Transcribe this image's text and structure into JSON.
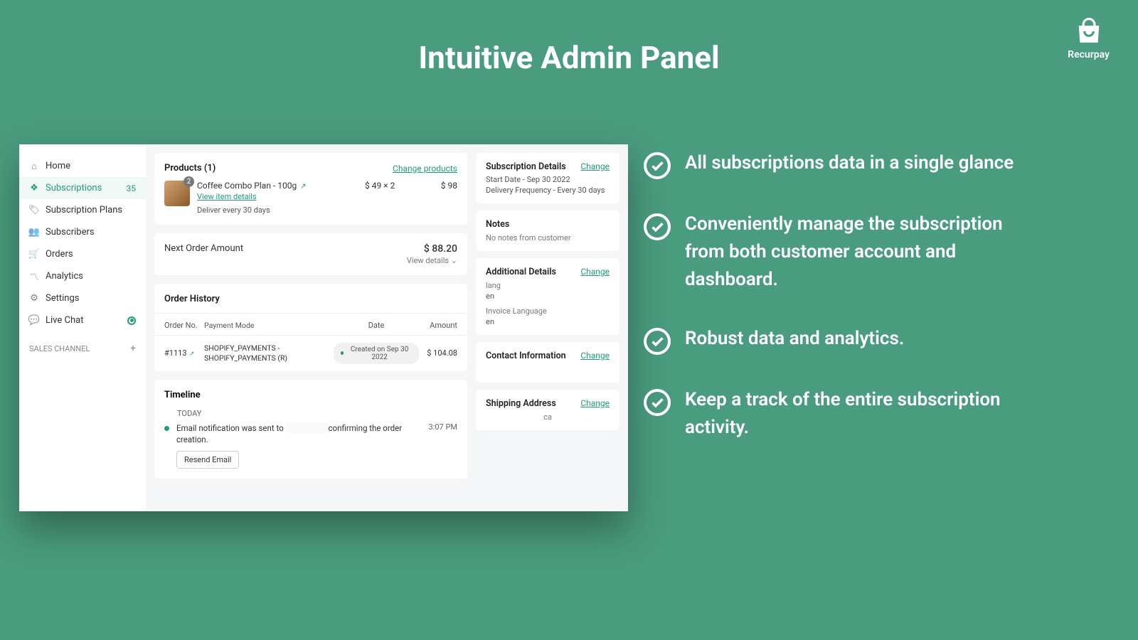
{
  "hero": {
    "title": "Intuitive Admin Panel",
    "brand": "Recurpay"
  },
  "sidebar": {
    "items": [
      {
        "label": "Home"
      },
      {
        "label": "Subscriptions",
        "badge": "35"
      },
      {
        "label": "Subscription Plans"
      },
      {
        "label": "Subscribers"
      },
      {
        "label": "Orders"
      },
      {
        "label": "Analytics"
      },
      {
        "label": "Settings"
      },
      {
        "label": "Live Chat"
      }
    ],
    "section": "SALES CHANNEL"
  },
  "products": {
    "title": "Products (1)",
    "change": "Change products",
    "item": {
      "name": "Coffee Combo Plan - 100g",
      "count": "2",
      "view_item": "View item details",
      "delivery": "Deliver every 30 days",
      "price": "$ 49 × 2",
      "total": "$ 98"
    }
  },
  "next_order": {
    "label": "Next Order Amount",
    "amount": "$ 88.20",
    "view": "View details ⌄"
  },
  "order_history": {
    "title": "Order History",
    "headers": {
      "order_no": "Order No.",
      "payment": "Payment Mode",
      "date": "Date",
      "amount": "Amount"
    },
    "row": {
      "order_no": "#1113",
      "payment": "SHOPIFY_PAYMENTS - SHOPIFY_PAYMENTS (R)",
      "date": "Created on Sep 30 2022",
      "amount": "$ 104.08"
    }
  },
  "timeline": {
    "title": "Timeline",
    "today": "TODAY",
    "event": {
      "prefix": "Email notification was sent to",
      "suffix": "confirming the order creation.",
      "time": "3:07 PM"
    },
    "resend": "Resend Email"
  },
  "right": {
    "sub_details": {
      "title": "Subscription Details",
      "change": "Change",
      "start": "Start Date - Sep 30 2022",
      "freq": "Delivery Frequency - Every 30 days"
    },
    "notes": {
      "title": "Notes",
      "text": "No notes from customer"
    },
    "additional": {
      "title": "Additional Details",
      "change": "Change",
      "lang_label": "lang",
      "lang_val": "en",
      "inv_label": "Invoice Language",
      "inv_val": "en"
    },
    "contact": {
      "title": "Contact Information",
      "change": "Change"
    },
    "shipping": {
      "title": "Shipping Address",
      "change": "Change",
      "line": "ca"
    }
  },
  "features": [
    "All subscriptions data in a single glance",
    "Conveniently manage the subscription from both customer account and dashboard.",
    "Robust data and analytics.",
    "Keep a track of the entire subscription activity."
  ]
}
